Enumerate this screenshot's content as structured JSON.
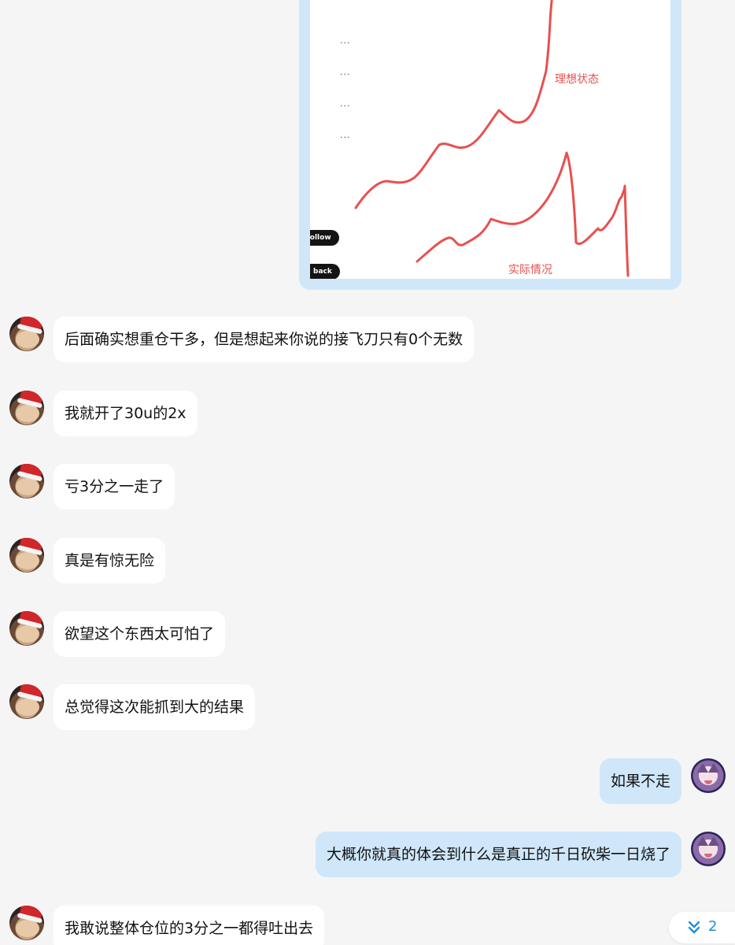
{
  "image_message": {
    "dots": [
      "...",
      "...",
      "...",
      "..."
    ],
    "buttons": [
      "Follow",
      "back"
    ],
    "labels": {
      "ideal": "理想状态",
      "actual": "实际情况"
    },
    "line_color": "#e8504f"
  },
  "messages": [
    {
      "side": "other",
      "text": "后面确实想重仓干多，但是想起来你说的接飞刀只有0个无数"
    },
    {
      "side": "other",
      "text": "我就开了30u的2x"
    },
    {
      "side": "other",
      "text": "亏3分之一走了"
    },
    {
      "side": "other",
      "text": "真是有惊无险"
    },
    {
      "side": "other",
      "text": "欲望这个东西太可怕了"
    },
    {
      "side": "other",
      "text": "总觉得这次能抓到大的结果"
    },
    {
      "side": "self",
      "text": "如果不走"
    },
    {
      "side": "self",
      "text": "大概你就真的体会到什么是真正的千日砍柴一日烧了"
    },
    {
      "side": "other",
      "text": "我敢说整体仓位的3分之一都得吐出去"
    }
  ],
  "unread_jump": {
    "icon": "double-chevron-down-icon",
    "count": "2"
  },
  "colors": {
    "self_bubble": "#cfe7f9",
    "other_bubble": "#ffffff",
    "background": "#f5f5f5"
  }
}
